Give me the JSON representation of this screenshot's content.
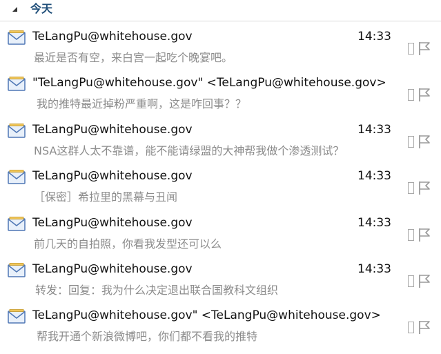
{
  "group": {
    "label": "今天"
  },
  "items": [
    {
      "sender": "TeLangPu@whitehouse.gov",
      "time": "14:33",
      "preview": "最近是否有空，来白宫一起吃个晚宴吧。"
    },
    {
      "sender": "\"TeLangPu@whitehouse.gov\" <TeLangPu@whitehouse.gov>",
      "time": "",
      "preview": "我的推特最近掉粉严重啊，这是咋回事？？"
    },
    {
      "sender": "TeLangPu@whitehouse.gov",
      "time": "14:33",
      "preview": "NSA这群人太不靠谱，能不能请绿盟的大神帮我做个渗透测试？"
    },
    {
      "sender": "TeLangPu@whitehouse.gov",
      "time": "14:33",
      "preview": "［保密］希拉里的黑幕与丑闻"
    },
    {
      "sender": "TeLangPu@whitehouse.gov",
      "time": "14:33",
      "preview": "前几天的自拍照，你看我发型还可以么"
    },
    {
      "sender": "TeLangPu@whitehouse.gov",
      "time": "14:33",
      "preview": "转发：回复：我为什么决定退出联合国教科文组织"
    },
    {
      "sender": "TeLangPu@whitehouse.gov\" <TeLangPu@whitehouse.gov>",
      "time": "",
      "preview": "帮我开通个新浪微博吧，你们都不看我的推特"
    }
  ],
  "icons": {
    "mail": "envelope-icon",
    "category": "category-box",
    "flag": "flag-icon"
  },
  "colors": {
    "group_label": "#1f4e79",
    "sender": "#111111",
    "preview": "#8c8c8c",
    "separator": "#d9d9d9"
  }
}
